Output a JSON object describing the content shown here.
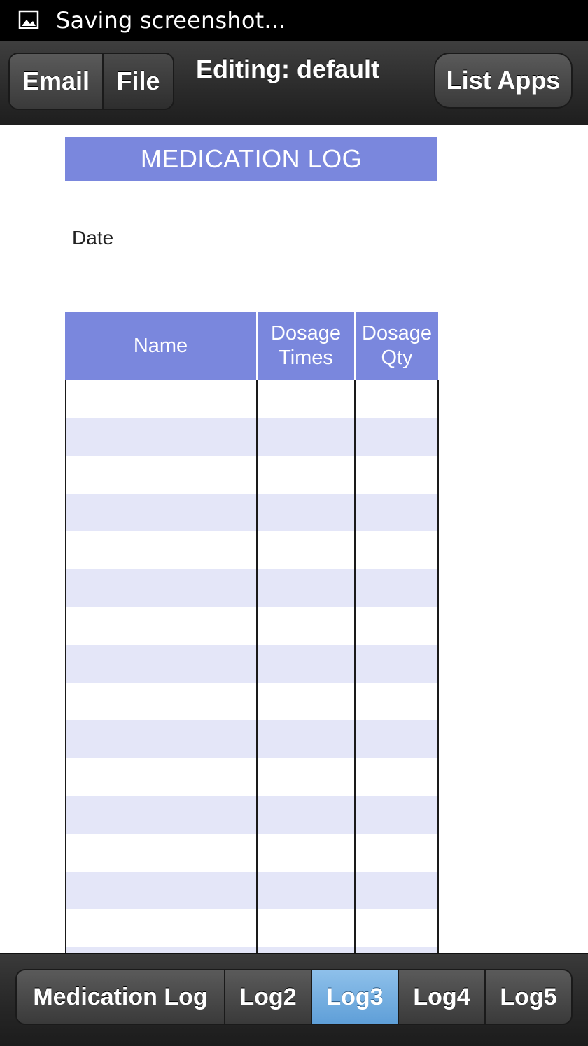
{
  "status_bar": {
    "text": "Saving screenshot..."
  },
  "toolbar": {
    "email_label": "Email",
    "file_label": "File",
    "title": "Editing: default",
    "list_apps_label": "List Apps"
  },
  "sheet": {
    "title": "MEDICATION LOG",
    "date_label": "Date",
    "columns": [
      {
        "line1": "Name",
        "line2": ""
      },
      {
        "line1": "Dosage",
        "line2": "Times"
      },
      {
        "line1": "Dosage",
        "line2": "Qty"
      }
    ],
    "header_color": "#7a87dd",
    "alt_row_color": "#e4e6f8"
  },
  "tabs": [
    {
      "label": "Medication Log",
      "active": false
    },
    {
      "label": "Log2",
      "active": false
    },
    {
      "label": "Log3",
      "active": true
    },
    {
      "label": "Log4",
      "active": false
    },
    {
      "label": "Log5",
      "active": false
    }
  ]
}
